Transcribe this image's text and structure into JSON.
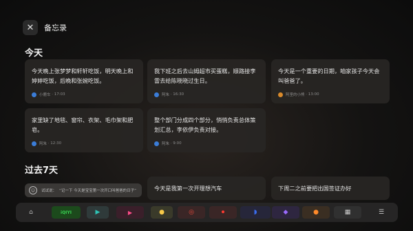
{
  "header": {
    "title": "备忘录"
  },
  "sections": {
    "today": "今天",
    "past7": "过去7天"
  },
  "today_cards": [
    {
      "text": "今天晚上张梦梦和轩轩吃饭，明天晚上和婷婷吃饭，后晚和张婉吃饭。",
      "author": "小鹿车",
      "time": "17:03",
      "avatar_color": "#3b7dd8"
    },
    {
      "text": "我下班之后去山姆超市买蛋糕，顺路接李雷去给陈晓晓过生日。",
      "author": "阿朱",
      "time": "16:30",
      "avatar_color": "#3b7dd8"
    },
    {
      "text": "今天是一个重要的日期，咱家孩子今天会叫爸爸了。",
      "author": "阿坚的小熊",
      "time": "13:00",
      "avatar_color": "#d98a2b"
    },
    {
      "text": "家里缺了地毯、窗帘、衣架、毛巾架和肥皂。",
      "author": "阿朱",
      "time": "12:30",
      "avatar_color": "#3b7dd8"
    },
    {
      "text": "整个部门分成四个部分，悄悄负责总体策划汇总，李依伊负责对接。",
      "author": "阿朱",
      "time": "9:00",
      "avatar_color": "#3b7dd8"
    }
  ],
  "past_cards": [
    {
      "text": "今天是我第一次开理想汽车"
    },
    {
      "text": "下周二之前要把出国签证办好"
    }
  ],
  "voice_hint": {
    "prefix": "试试说：",
    "text": "“记一下 今天是宝宝第一次开口叫爸爸的日子”"
  },
  "dock": {
    "iqiyi_label": "iQIYI",
    "apps": [
      "home-icon",
      "iqiyi-icon",
      "play-store-icon",
      "video-app-icon",
      "smiley-app-icon",
      "target-app-icon",
      "record-app-icon",
      "cap-app-icon",
      "purple-app-icon",
      "orange-face-app-icon",
      "grid-app-icon",
      "layout-toggle-icon"
    ]
  }
}
